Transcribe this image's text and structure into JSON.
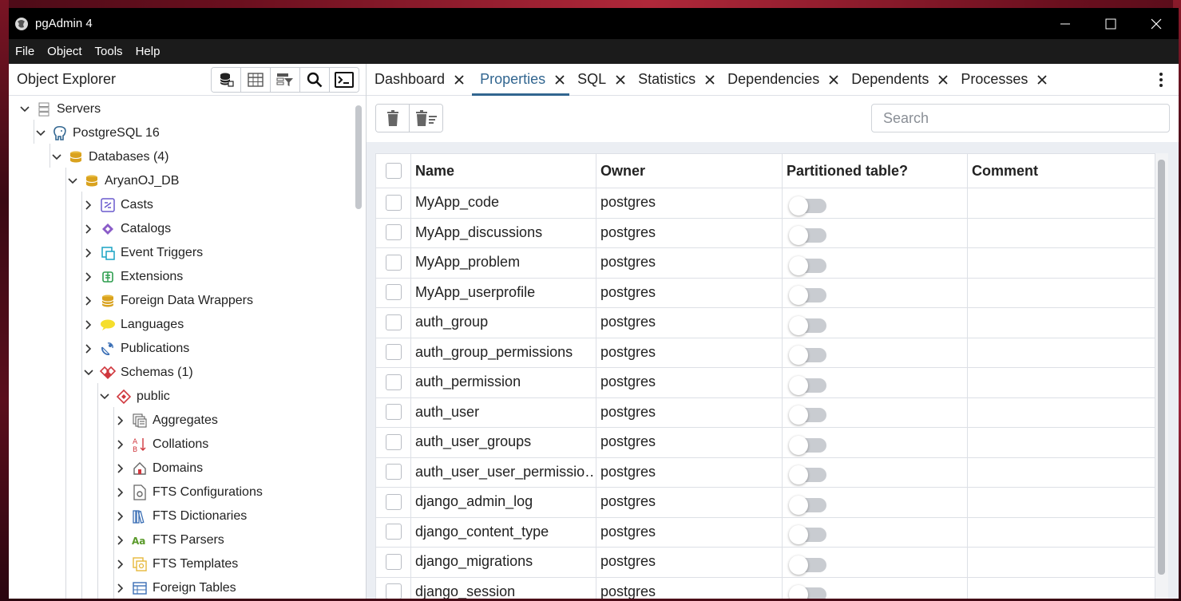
{
  "window": {
    "title": "pgAdmin 4"
  },
  "menu": [
    "File",
    "Object",
    "Tools",
    "Help"
  ],
  "sidebar": {
    "title": "Object Explorer",
    "tree": [
      {
        "label": "Servers",
        "level": 0,
        "expanded": true,
        "icon": "servers-icon"
      },
      {
        "label": "PostgreSQL 16",
        "level": 1,
        "expanded": true,
        "icon": "postgresql-icon"
      },
      {
        "label": "Databases (4)",
        "level": 2,
        "expanded": true,
        "icon": "databases-icon"
      },
      {
        "label": "AryanOJ_DB",
        "level": 3,
        "expanded": true,
        "icon": "database-icon"
      },
      {
        "label": "Casts",
        "level": 4,
        "expanded": false,
        "icon": "casts-icon"
      },
      {
        "label": "Catalogs",
        "level": 4,
        "expanded": false,
        "icon": "catalogs-icon"
      },
      {
        "label": "Event Triggers",
        "level": 4,
        "expanded": false,
        "icon": "event-triggers-icon"
      },
      {
        "label": "Extensions",
        "level": 4,
        "expanded": false,
        "icon": "extensions-icon"
      },
      {
        "label": "Foreign Data Wrappers",
        "level": 4,
        "expanded": false,
        "icon": "foreign-data-wrappers-icon"
      },
      {
        "label": "Languages",
        "level": 4,
        "expanded": false,
        "icon": "languages-icon"
      },
      {
        "label": "Publications",
        "level": 4,
        "expanded": false,
        "icon": "publications-icon"
      },
      {
        "label": "Schemas (1)",
        "level": 4,
        "expanded": true,
        "icon": "schemas-icon"
      },
      {
        "label": "public",
        "level": 5,
        "expanded": true,
        "icon": "schema-icon"
      },
      {
        "label": "Aggregates",
        "level": 6,
        "expanded": false,
        "icon": "aggregates-icon"
      },
      {
        "label": "Collations",
        "level": 6,
        "expanded": false,
        "icon": "collations-icon"
      },
      {
        "label": "Domains",
        "level": 6,
        "expanded": false,
        "icon": "domains-icon"
      },
      {
        "label": "FTS Configurations",
        "level": 6,
        "expanded": false,
        "icon": "fts-configurations-icon"
      },
      {
        "label": "FTS Dictionaries",
        "level": 6,
        "expanded": false,
        "icon": "fts-dictionaries-icon"
      },
      {
        "label": "FTS Parsers",
        "level": 6,
        "expanded": false,
        "icon": "fts-parsers-icon"
      },
      {
        "label": "FTS Templates",
        "level": 6,
        "expanded": false,
        "icon": "fts-templates-icon"
      },
      {
        "label": "Foreign Tables",
        "level": 6,
        "expanded": false,
        "icon": "foreign-tables-icon"
      }
    ]
  },
  "tabs": [
    {
      "label": "Dashboard",
      "active": false
    },
    {
      "label": "Properties",
      "active": true
    },
    {
      "label": "SQL",
      "active": false
    },
    {
      "label": "Statistics",
      "active": false
    },
    {
      "label": "Dependencies",
      "active": false
    },
    {
      "label": "Dependents",
      "active": false
    },
    {
      "label": "Processes",
      "active": false
    }
  ],
  "search": {
    "placeholder": "Search",
    "value": ""
  },
  "table": {
    "columns": [
      "Name",
      "Owner",
      "Partitioned table?",
      "Comment"
    ],
    "rows": [
      {
        "name": "MyApp_code",
        "owner": "postgres",
        "partitioned": false,
        "comment": ""
      },
      {
        "name": "MyApp_discussions",
        "owner": "postgres",
        "partitioned": false,
        "comment": ""
      },
      {
        "name": "MyApp_problem",
        "owner": "postgres",
        "partitioned": false,
        "comment": ""
      },
      {
        "name": "MyApp_userprofile",
        "owner": "postgres",
        "partitioned": false,
        "comment": ""
      },
      {
        "name": "auth_group",
        "owner": "postgres",
        "partitioned": false,
        "comment": ""
      },
      {
        "name": "auth_group_permissions",
        "owner": "postgres",
        "partitioned": false,
        "comment": ""
      },
      {
        "name": "auth_permission",
        "owner": "postgres",
        "partitioned": false,
        "comment": ""
      },
      {
        "name": "auth_user",
        "owner": "postgres",
        "partitioned": false,
        "comment": ""
      },
      {
        "name": "auth_user_groups",
        "owner": "postgres",
        "partitioned": false,
        "comment": ""
      },
      {
        "name": "auth_user_user_permissio…",
        "owner": "postgres",
        "partitioned": false,
        "comment": ""
      },
      {
        "name": "django_admin_log",
        "owner": "postgres",
        "partitioned": false,
        "comment": ""
      },
      {
        "name": "django_content_type",
        "owner": "postgres",
        "partitioned": false,
        "comment": ""
      },
      {
        "name": "django_migrations",
        "owner": "postgres",
        "partitioned": false,
        "comment": ""
      },
      {
        "name": "django_session",
        "owner": "postgres",
        "partitioned": false,
        "comment": ""
      }
    ]
  },
  "colors": {
    "accent": "#326690",
    "titlebar": "#000000",
    "menubar": "#1b1b1b",
    "panel_bg": "#ebeef3"
  }
}
